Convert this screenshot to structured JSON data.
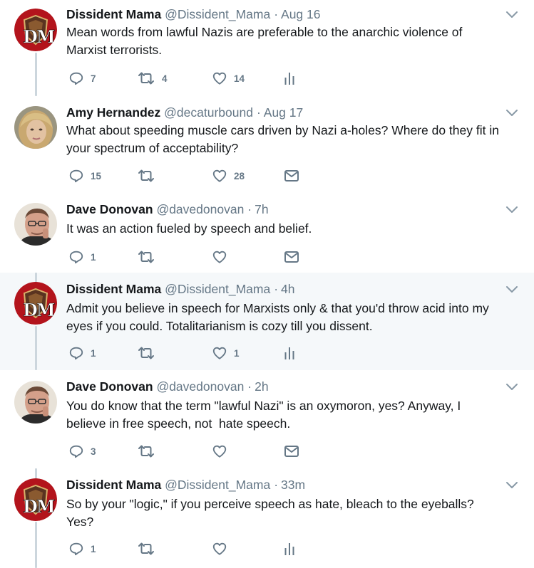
{
  "accent_color": "#1da1f2",
  "icon_color": "#657786",
  "tweets": [
    {
      "avatar": "dissident-mama-logo",
      "name": "Dissident Mama",
      "handle": "@Dissident_Mama",
      "time": "Aug 16",
      "text": [
        "Mean words from lawful Nazis are preferable to the anarchic violence of",
        "Marxist terrorists."
      ],
      "replies": "7",
      "retweets": "4",
      "likes": "14",
      "extra_icon": "analytics-icon",
      "highlighted": false
    },
    {
      "avatar": "amy-photo",
      "name": "Amy Hernandez",
      "handle": "@decaturbound",
      "time": "Aug 17",
      "text": [
        "What about speeding muscle cars driven by Nazi a-holes? Where do they fit in",
        "your spectrum of acceptability?"
      ],
      "replies": "15",
      "retweets": "",
      "likes": "28",
      "extra_icon": "direct-message-icon",
      "highlighted": false
    },
    {
      "avatar": "dave-photo",
      "name": "Dave Donovan",
      "handle": "@davedonovan",
      "time": "7h",
      "text": [
        "It was an action fueled by speech and belief."
      ],
      "replies": "1",
      "retweets": "",
      "likes": "",
      "extra_icon": "direct-message-icon",
      "highlighted": false
    },
    {
      "avatar": "dissident-mama-logo",
      "name": "Dissident Mama",
      "handle": "@Dissident_Mama",
      "time": "4h",
      "text": [
        "Admit you believe in speech for Marxists only & that you'd throw acid into my",
        "eyes if you could. Totalitarianism is cozy till you dissent."
      ],
      "replies": "1",
      "retweets": "",
      "likes": "1",
      "extra_icon": "analytics-icon",
      "highlighted": true
    },
    {
      "avatar": "dave-photo",
      "name": "Dave Donovan",
      "handle": "@davedonovan",
      "time": "2h",
      "text": [
        "You do know that the term \"lawful Nazi\" is an oxymoron, yes? Anyway, I",
        "believe in free speech, not  hate speech."
      ],
      "replies": "3",
      "retweets": "",
      "likes": "",
      "extra_icon": "direct-message-icon",
      "highlighted": false
    },
    {
      "avatar": "dissident-mama-logo",
      "name": "Dissident Mama",
      "handle": "@Dissident_Mama",
      "time": "33m",
      "text": [
        "So by your \"logic,\" if you perceive speech as hate, bleach to the eyeballs?",
        "Yes?"
      ],
      "replies": "1",
      "retweets": "",
      "likes": "",
      "extra_icon": "analytics-icon",
      "highlighted": false
    }
  ]
}
